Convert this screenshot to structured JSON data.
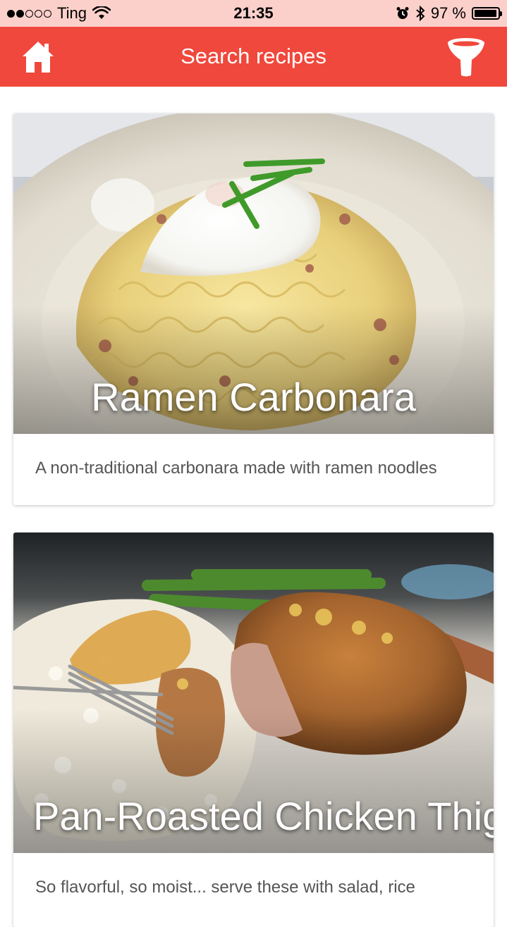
{
  "status_bar": {
    "carrier": "Ting",
    "time": "21:35",
    "battery_percent": "97 %",
    "signal_bars_filled": 2,
    "signal_bars_total": 5,
    "battery_level": 0.97
  },
  "navbar": {
    "title": "Search recipes",
    "home_icon": "home-icon",
    "filter_icon": "filter-funnel-icon",
    "background_color": "#f0483c"
  },
  "recipes": [
    {
      "title": "Ramen Carbonara",
      "description": "A non-traditional carbonara made with ramen noodles",
      "image_subject": "ramen noodles with poached egg and chives"
    },
    {
      "title": "Pan-Roasted Chicken Thighs",
      "description": "So flavorful, so moist... serve these with salad, rice",
      "image_subject": "pan-roasted chicken thigh with rice and asparagus"
    }
  ]
}
